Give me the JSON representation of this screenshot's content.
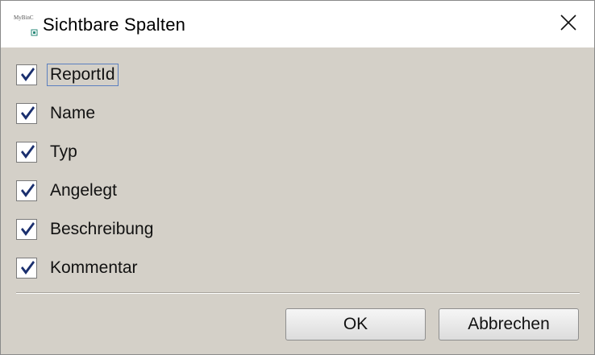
{
  "window": {
    "title": "Sichtbare Spalten",
    "app_icon": "mybinc-app-icon",
    "app_icon_text": "MyBinC",
    "close_icon": "close-icon"
  },
  "columns": [
    {
      "label": "ReportId",
      "checked": true,
      "focused": true
    },
    {
      "label": "Name",
      "checked": true,
      "focused": false
    },
    {
      "label": "Typ",
      "checked": true,
      "focused": false
    },
    {
      "label": "Angelegt",
      "checked": true,
      "focused": false
    },
    {
      "label": "Beschreibung",
      "checked": true,
      "focused": false
    },
    {
      "label": "Kommentar",
      "checked": true,
      "focused": false
    }
  ],
  "buttons": {
    "ok_label": "OK",
    "cancel_label": "Abbrechen"
  },
  "colors": {
    "dialog_background": "#d4d0c8",
    "titlebar_background": "#ffffff",
    "checkmark": "#1a2f6e",
    "focus_border": "#5b7fbf"
  }
}
